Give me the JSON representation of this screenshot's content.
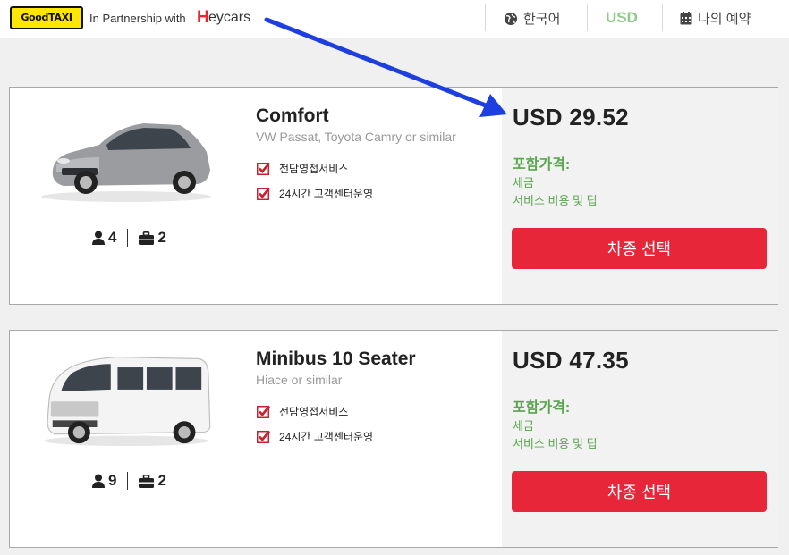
{
  "header": {
    "logo_text": "GoodTAXI",
    "partner_text": "In Partnership with",
    "heycars_h": "H",
    "heycars_rest": "eycars",
    "language": "한국어",
    "currency": "USD",
    "booking": "나의 예약",
    "colors": {
      "logo_bg": "#ffe600",
      "heycars_red": "#e8262e",
      "usd_green": "#8fca87"
    }
  },
  "cars": [
    {
      "name": "Comfort",
      "models": "VW Passat, Toyota Camry or similar",
      "features": [
        "전담영접서비스",
        "24시간 고객센터운영"
      ],
      "passengers": "4",
      "luggage": "2",
      "price": "USD 29.52",
      "included_title": "포함가격:",
      "included": [
        "세금",
        "서비스 비용 및 팁"
      ],
      "select_label": "차종 선택",
      "image_icon": "sedan-car-image"
    },
    {
      "name": "Minibus 10 Seater",
      "models": "Hiace or similar",
      "features": [
        "전담영접서비스",
        "24시간 고객센터운영"
      ],
      "passengers": "9",
      "luggage": "2",
      "price": "USD 47.35",
      "included_title": "포함가격:",
      "included": [
        "세금",
        "서비스 비용 및 팁"
      ],
      "select_label": "차종 선택",
      "image_icon": "minibus-van-image"
    }
  ],
  "colors": {
    "accent_red": "#e8263a",
    "included_green": "#5aa64e",
    "annotation_arrow": "#1d3fe0"
  }
}
